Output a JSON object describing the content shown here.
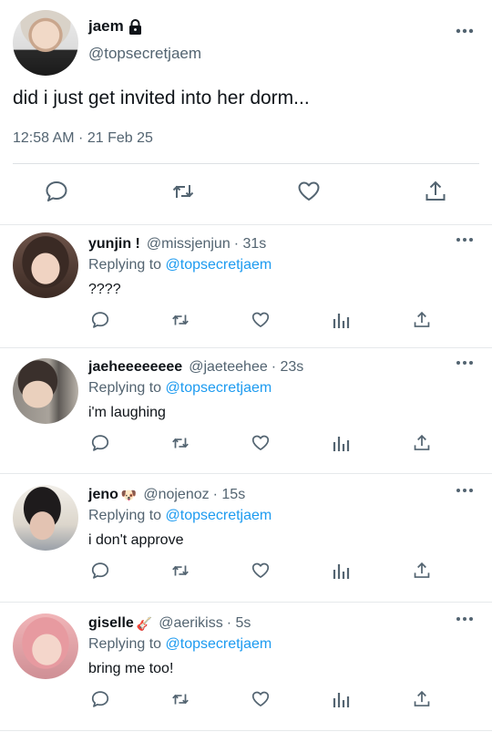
{
  "main_tweet": {
    "author_name": "jaem",
    "author_handle": "@topsecretjaem",
    "text": "did i just get invited into her dorm...",
    "timestamp": "12:58 AM · 21 Feb 25"
  },
  "icons": {
    "lock": "lock-icon",
    "more": "more-horizontal-icon",
    "reply": "reply-bubble-icon",
    "retweet": "retweet-icon",
    "like": "heart-icon",
    "views": "views-bar-icon",
    "share": "share-upload-icon"
  },
  "colors": {
    "text": "#0f1419",
    "secondary": "#536471",
    "link": "#1d9bf0",
    "divider": "#e6e9eb"
  },
  "replies": [
    {
      "name": "yunjin !",
      "emoji": "",
      "handle": "@missjenjun",
      "time": "· 31s",
      "replying_label": "Replying to",
      "mention": "@topsecretjaem",
      "text": "????"
    },
    {
      "name": "jaeheeeeeeee",
      "emoji": "",
      "handle": "@jaeteehee",
      "time": "· 23s",
      "replying_label": "Replying to",
      "mention": "@topsecretjaem",
      "text": "i'm laughing"
    },
    {
      "name": "jeno",
      "emoji": "🐶",
      "handle": "@nojenoz",
      "time": "· 15s",
      "replying_label": "Replying to",
      "mention": "@topsecretjaem",
      "text": "i don't approve"
    },
    {
      "name": "giselle",
      "emoji": "🎸",
      "handle": "@aerikiss",
      "time": "· 5s",
      "replying_label": "Replying to",
      "mention": "@topsecretjaem",
      "text": "bring me too!"
    }
  ]
}
